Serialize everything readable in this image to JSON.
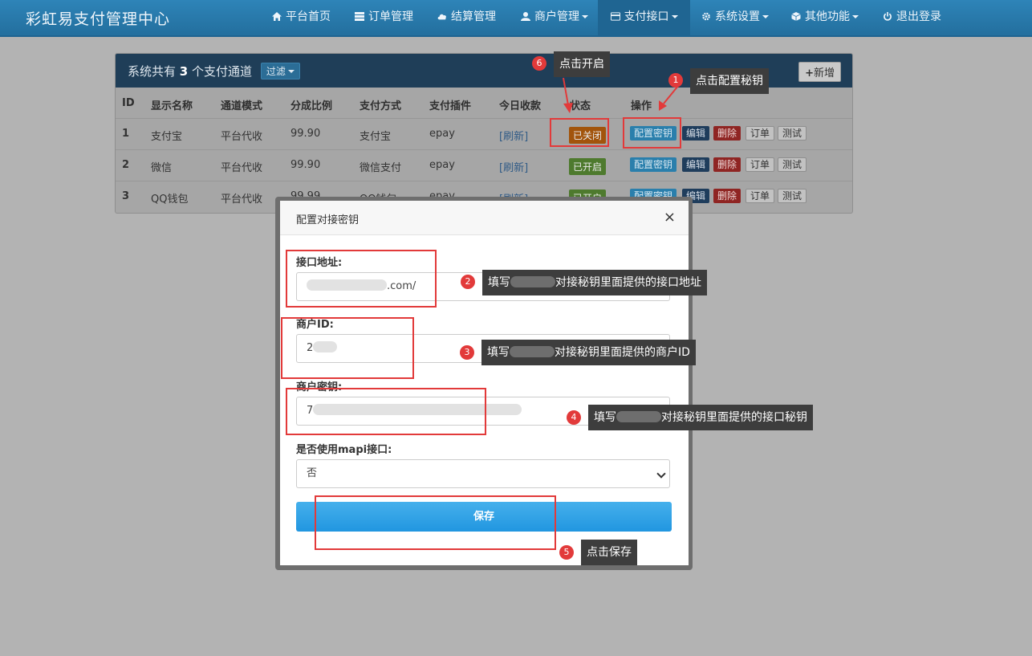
{
  "navbar": {
    "brand": "彩虹易支付管理中心",
    "items": [
      {
        "label": "平台首页",
        "icon": "home-icon"
      },
      {
        "label": "订单管理",
        "icon": "list-icon"
      },
      {
        "label": "结算管理",
        "icon": "cloud-icon"
      },
      {
        "label": "商户管理",
        "icon": "user-icon"
      },
      {
        "label": "支付接口",
        "icon": "card-icon"
      },
      {
        "label": "系统设置",
        "icon": "gear-icon"
      },
      {
        "label": "其他功能",
        "icon": "cube-icon"
      },
      {
        "label": "退出登录",
        "icon": "power-icon"
      }
    ]
  },
  "panel": {
    "title_prefix": "系统共有",
    "count": "3",
    "title_suffix": "个支付通道",
    "filter_label": "过滤",
    "add_label": "新增",
    "columns": [
      "ID",
      "显示名称",
      "通道模式",
      "分成比例",
      "支付方式",
      "支付插件",
      "今日收款",
      "状态",
      "操作"
    ],
    "rows": [
      {
        "id": "1",
        "name": "支付宝",
        "mode": "平台代收",
        "rate": "99.90",
        "method": "支付宝",
        "plugin": "epay",
        "today": "[刷新]",
        "status": "已关闭"
      },
      {
        "id": "2",
        "name": "微信",
        "mode": "平台代收",
        "rate": "99.90",
        "method": "微信支付",
        "plugin": "epay",
        "today": "[刷新]",
        "status": "已开启"
      },
      {
        "id": "3",
        "name": "QQ钱包",
        "mode": "平台代收",
        "rate": "99.99",
        "method": "QQ钱包",
        "plugin": "epay",
        "today": "[刷新]",
        "status": "已开启"
      }
    ],
    "actions": {
      "config_key": "配置密钥",
      "edit": "编辑",
      "delete": "删除",
      "orders": "订单",
      "test": "测试"
    }
  },
  "modal": {
    "title": "配置对接密钥",
    "close": "×",
    "fields": [
      {
        "label": "接口地址:",
        "value": ".com/"
      },
      {
        "label": "商户ID:",
        "value": "2"
      },
      {
        "label": "商户密钥:",
        "value": "7"
      },
      {
        "label": "是否使用mapi接口:",
        "value": "否"
      }
    ],
    "save_label": "保存"
  },
  "annotations": [
    {
      "num": "1",
      "text": "点击配置秘钥"
    },
    {
      "num": "2",
      "text_before": "填写",
      "text_after": "对接秘钥里面提供的接口地址"
    },
    {
      "num": "3",
      "text_before": "填写",
      "text_after": "对接秘钥里面提供的商户ID"
    },
    {
      "num": "4",
      "text_before": "填写",
      "text_after": "对接秘钥里面提供的接口秘钥"
    },
    {
      "num": "5",
      "text": "点击保存"
    },
    {
      "num": "6",
      "text": "点击开启"
    }
  ],
  "colors": {
    "accent": "#e23a3a",
    "navbar": "#2a7ab0",
    "save": "#2196e0"
  }
}
